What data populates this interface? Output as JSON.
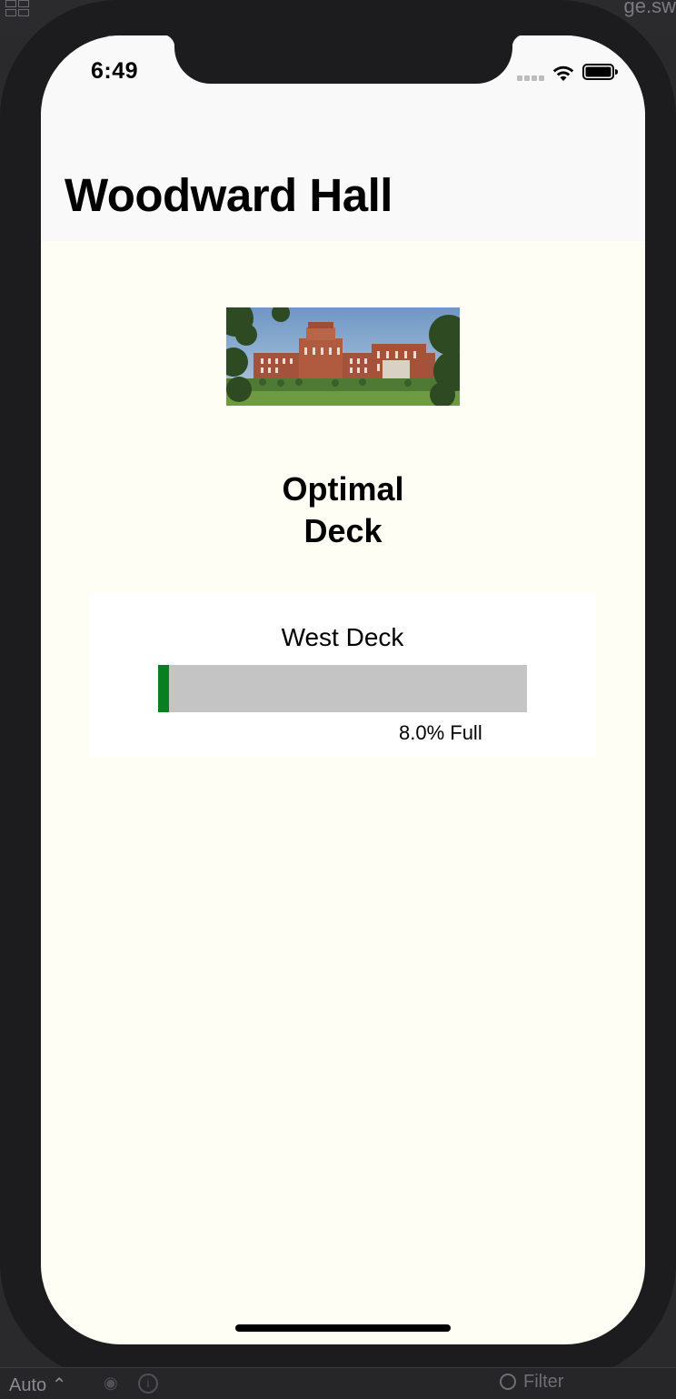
{
  "status_bar": {
    "time": "6:49"
  },
  "nav": {
    "title": "Woodward Hall"
  },
  "hero_image": {
    "alt": "Woodward Hall building"
  },
  "section": {
    "title_line1": "Optimal",
    "title_line2": "Deck"
  },
  "deck_card": {
    "name": "West Deck",
    "fill_fraction": 0.03,
    "caption": "8.0% Full",
    "fill_color": "#0a7f20",
    "track_color": "#c4c4c4"
  },
  "xcode": {
    "file_tab": "ge.sw",
    "appearance": "Auto",
    "filter": "Filter"
  },
  "icons": [
    "grid-icon",
    "signal-icon",
    "wifi-icon",
    "battery-icon",
    "eye-icon",
    "info-icon",
    "filter-icon"
  ]
}
